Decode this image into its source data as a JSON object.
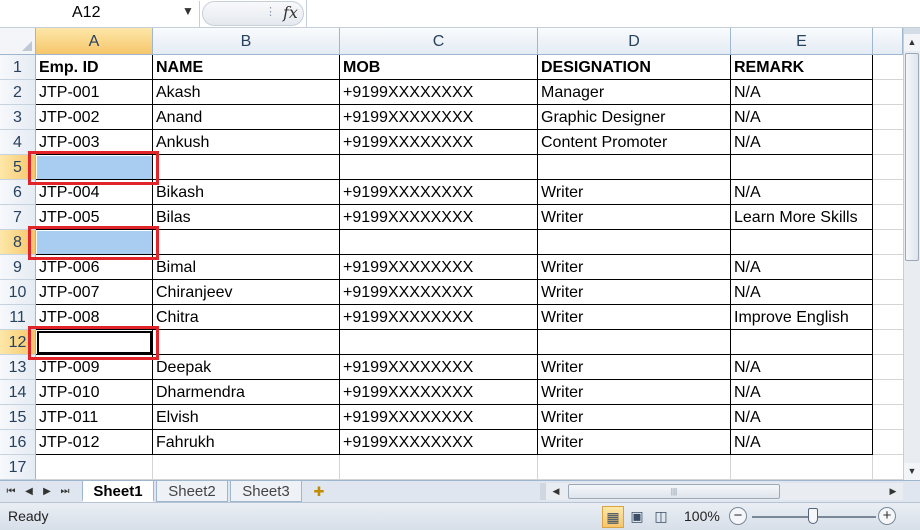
{
  "formula_bar": {
    "name_box": "A12",
    "fx_label": "fx",
    "formula": ""
  },
  "columns": [
    "A",
    "B",
    "C",
    "D",
    "E"
  ],
  "selected_column": "A",
  "rows": [
    {
      "n": "1",
      "cells": [
        "Emp. ID",
        "NAME",
        "MOB",
        "DESIGNATION",
        "REMARK"
      ]
    },
    {
      "n": "2",
      "cells": [
        "JTP-001",
        "Akash",
        "+9199XXXXXXXX",
        "Manager",
        "N/A"
      ]
    },
    {
      "n": "3",
      "cells": [
        "JTP-002",
        "Anand",
        "+9199XXXXXXXX",
        "Graphic Designer",
        "N/A"
      ]
    },
    {
      "n": "4",
      "cells": [
        "JTP-003",
        "Ankush",
        "+9199XXXXXXXX",
        "Content Promoter",
        "N/A"
      ]
    },
    {
      "n": "5",
      "cells": [
        "",
        "",
        "",
        "",
        ""
      ]
    },
    {
      "n": "6",
      "cells": [
        "JTP-004",
        "Bikash",
        "+9199XXXXXXXX",
        "Writer",
        "N/A"
      ]
    },
    {
      "n": "7",
      "cells": [
        "JTP-005",
        "Bilas",
        "+9199XXXXXXXX",
        "Writer",
        "Learn More Skills"
      ]
    },
    {
      "n": "8",
      "cells": [
        "",
        "",
        "",
        "",
        ""
      ]
    },
    {
      "n": "9",
      "cells": [
        "JTP-006",
        "Bimal",
        "+9199XXXXXXXX",
        "Writer",
        "N/A"
      ]
    },
    {
      "n": "10",
      "cells": [
        "JTP-007",
        "Chiranjeev",
        "+9199XXXXXXXX",
        "Writer",
        "N/A"
      ]
    },
    {
      "n": "11",
      "cells": [
        "JTP-008",
        "Chitra",
        "+9199XXXXXXXX",
        "Writer",
        "Improve English"
      ]
    },
    {
      "n": "12",
      "cells": [
        "",
        "",
        "",
        "",
        ""
      ]
    },
    {
      "n": "13",
      "cells": [
        "JTP-009",
        "Deepak",
        "+9199XXXXXXXX",
        "Writer",
        "N/A"
      ]
    },
    {
      "n": "14",
      "cells": [
        "JTP-010",
        "Dharmendra",
        "+9199XXXXXXXX",
        "Writer",
        "N/A"
      ]
    },
    {
      "n": "15",
      "cells": [
        "JTP-011",
        "Elvish",
        "+9199XXXXXXXX",
        "Writer",
        "N/A"
      ]
    },
    {
      "n": "16",
      "cells": [
        "JTP-012",
        "Fahrukh",
        "+9199XXXXXXXX",
        "Writer",
        "N/A"
      ]
    },
    {
      "n": "17",
      "cells": [
        "",
        "",
        "",
        "",
        ""
      ]
    }
  ],
  "selected_rows": [
    "5",
    "8",
    "12"
  ],
  "active_cell": "A12",
  "sheet_tabs": [
    "Sheet1",
    "Sheet2",
    "Sheet3"
  ],
  "active_sheet": "Sheet1",
  "status_bar": {
    "ready": "Ready",
    "zoom": "100%"
  },
  "colors": {
    "selection_fill": "#a9cdf0",
    "highlight_box": "#e0242a",
    "header_selected": "#f6c66b"
  }
}
